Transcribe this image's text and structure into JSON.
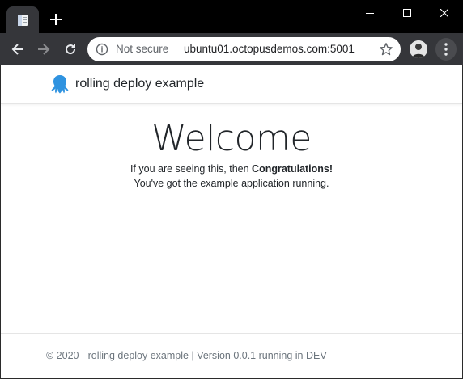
{
  "browser": {
    "not_secure_label": "Not secure",
    "url": "ubuntu01.octopusdemos.com:5001",
    "new_tab_glyph": "+",
    "colors": {
      "titlebar": "#000000",
      "toolbar": "#35363a",
      "omnibox": "#ffffff"
    }
  },
  "header": {
    "brand_name": "rolling deploy example",
    "logo_icon": "octopus-icon",
    "logo_color": "#2f93e0"
  },
  "main": {
    "heading": "Welcome",
    "line1_prefix": "If you are seeing this, then ",
    "line1_strong": "Congratulations!",
    "line2": "You've got the example application running."
  },
  "footer": {
    "text": "© 2020 - rolling deploy example | Version 0.0.1 running in DEV"
  }
}
